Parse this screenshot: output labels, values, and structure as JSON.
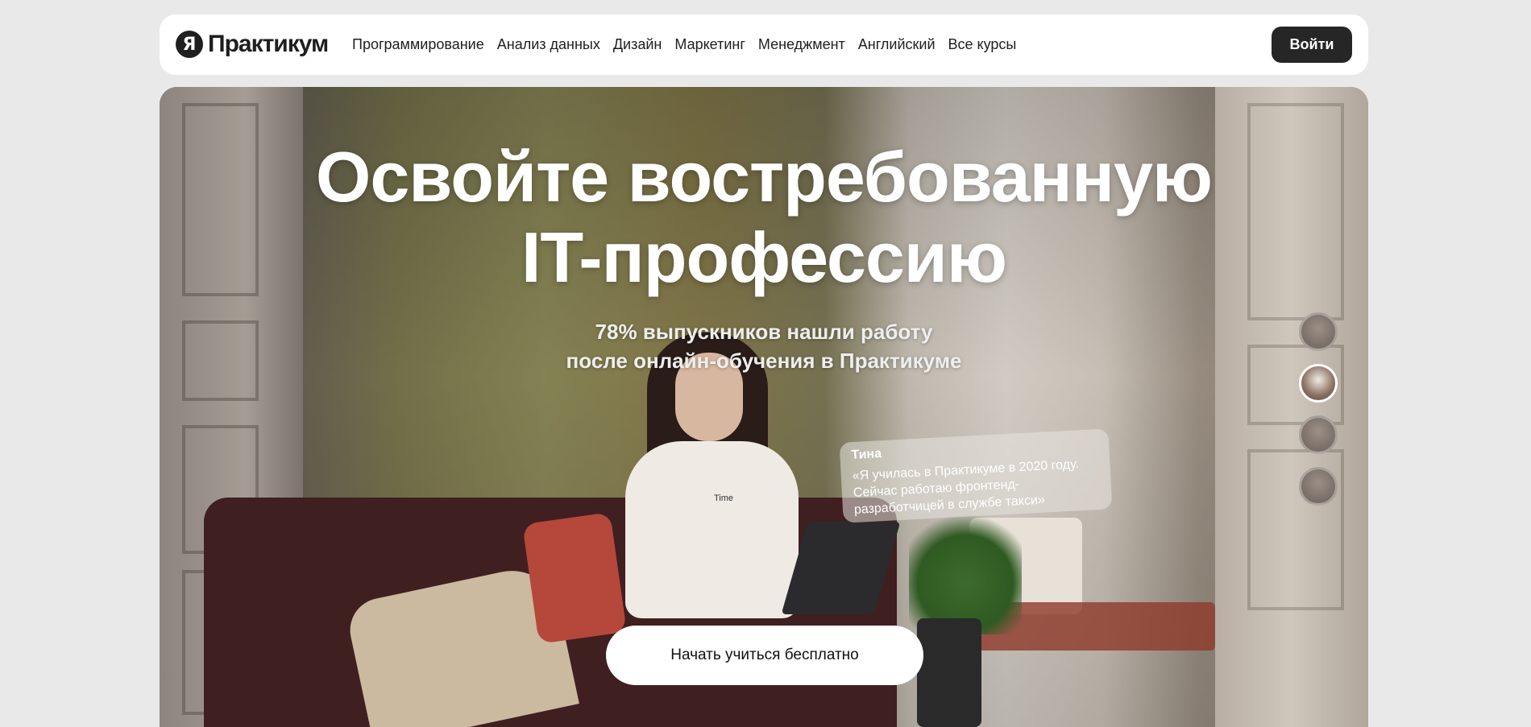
{
  "header": {
    "logo_mark": "Я",
    "logo_text": "Практикум",
    "nav": [
      {
        "label": "Программирование"
      },
      {
        "label": "Анализ данных"
      },
      {
        "label": "Дизайн"
      },
      {
        "label": "Маркетинг"
      },
      {
        "label": "Менеджмент"
      },
      {
        "label": "Английский"
      },
      {
        "label": "Все курсы"
      }
    ],
    "login_label": "Войти"
  },
  "hero": {
    "headline_line1": "Освойте востребованную",
    "headline_line2": "IT-профессию",
    "sub_line1": "78% выпускников нашли работу",
    "sub_line2": "после онлайн-обучения в Практикуме",
    "shirt_print": "Time",
    "testimonial": {
      "name": "Тина",
      "quote": "«Я училась в Практикуме в 2020 году. Сейчас работаю фронтенд-разработчицей в службе такси»"
    },
    "avatars_count": 4,
    "active_avatar_index": 1,
    "cta_label": "Начать учиться бесплатно"
  },
  "colors": {
    "page_bg": "#e9e9e9",
    "header_bg": "#ffffff",
    "login_button_bg": "#262626",
    "text_dark": "#1f1f1f",
    "cta_bg": "#ffffff"
  }
}
